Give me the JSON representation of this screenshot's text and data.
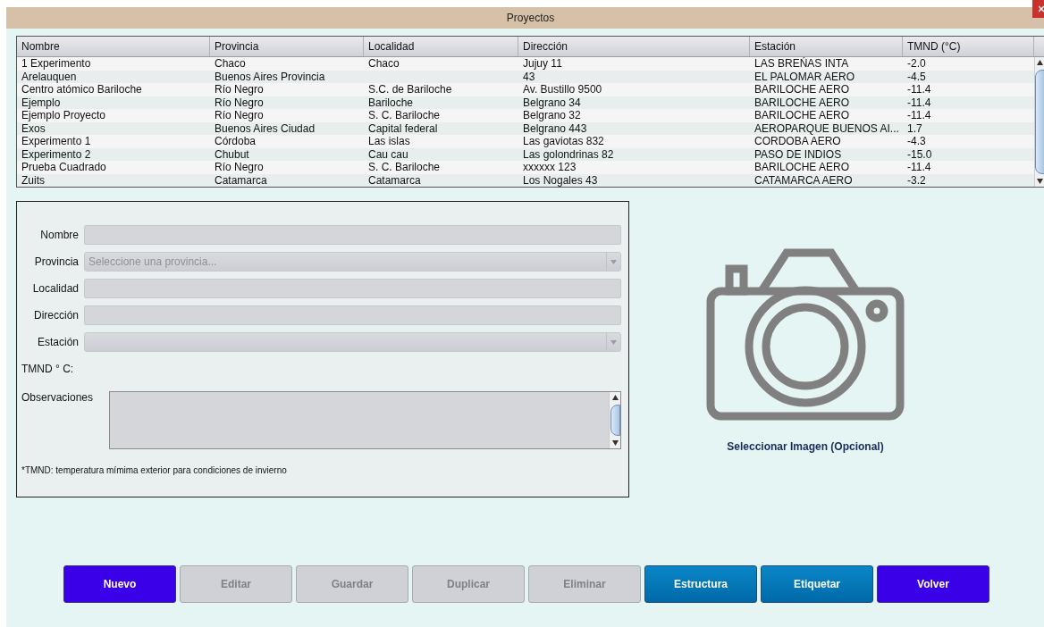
{
  "window": {
    "title": "Proyectos"
  },
  "table": {
    "columns": [
      "Nombre",
      "Provincia",
      "Localidad",
      "Dirección",
      "Estación",
      "TMND (°C)"
    ],
    "rows": [
      [
        "1 Experimento",
        "Chaco",
        "Chaco",
        "Jujuy 11",
        "LAS BREŃAS INTA",
        "-2.0"
      ],
      [
        "Arelauquen",
        "Buenos Aires Provincia",
        "",
        "43",
        "EL PALOMAR AERO",
        "-4.5"
      ],
      [
        "Centro atómico Bariloche",
        "Río Negro",
        "S.C. de Bariloche",
        "Av. Bustillo 9500",
        "BARILOCHE AERO",
        "-11.4"
      ],
      [
        "Ejemplo",
        "Río Negro",
        "Bariloche",
        "Belgrano 34",
        "BARILOCHE AERO",
        "-11.4"
      ],
      [
        "Ejemplo Proyecto",
        "Río Negro",
        "S. C. Bariloche",
        "Belgrano 32",
        "BARILOCHE AERO",
        "-11.4"
      ],
      [
        "Exos",
        "Buenos Aires Ciudad",
        "Capital federal",
        "Belgrano 443",
        "AEROPARQUE BUENOS AI...",
        "1.7"
      ],
      [
        "Experimento 1",
        "Córdoba",
        "Las islas",
        "Las gaviotas 832",
        "CORDOBA AERO",
        "-4.3"
      ],
      [
        "Experimento 2",
        "Chubut",
        "Cau cau",
        "Las golondrinas 82",
        "PASO DE INDIOS",
        "-15.0"
      ],
      [
        "Prueba Cuadrado",
        "Río Negro",
        "S. C. Bariloche",
        "xxxxxx 123",
        "BARILOCHE AERO",
        "-11.4"
      ],
      [
        "Zuits",
        "Catamarca",
        "Catamarca",
        "Los Nogales 43",
        "CATAMARCA AERO",
        "-3.2"
      ]
    ]
  },
  "form": {
    "fields": [
      {
        "label": "Nombre",
        "kind": "text"
      },
      {
        "label": "Provincia",
        "kind": "select",
        "placeholder": "Seleccione una provincia..."
      },
      {
        "label": "Localidad",
        "kind": "text"
      },
      {
        "label": "Dirección",
        "kind": "text"
      },
      {
        "label": "Estación",
        "kind": "select"
      },
      {
        "label": "TMND ° C:",
        "kind": "readout"
      },
      {
        "label": "Observaciones",
        "kind": "textarea"
      }
    ],
    "note": "*TMND: temperatura mímima exterior para condiciones de invierno"
  },
  "image_picker": {
    "label": "Seleccionar Imagen (Opcional)"
  },
  "buttons": [
    {
      "label": "Nuevo",
      "kind": "primary"
    },
    {
      "label": "Editar",
      "kind": "disabled"
    },
    {
      "label": "Guardar",
      "kind": "disabled"
    },
    {
      "label": "Duplicar",
      "kind": "disabled"
    },
    {
      "label": "Eliminar",
      "kind": "disabled"
    },
    {
      "label": "Estructura",
      "kind": "accent"
    },
    {
      "label": "Etiquetar",
      "kind": "accent"
    },
    {
      "label": "Volver",
      "kind": "primary"
    }
  ]
}
